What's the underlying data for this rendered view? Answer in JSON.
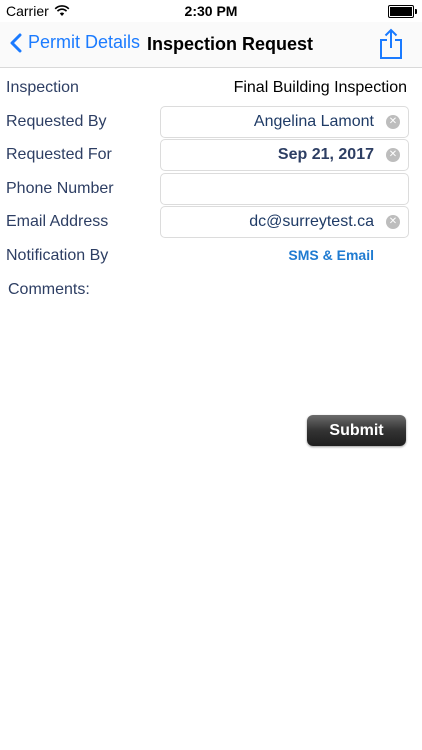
{
  "status_bar": {
    "carrier": "Carrier",
    "time": "2:30 PM"
  },
  "nav": {
    "back_label": "Permit Details",
    "title": "Inspection Request"
  },
  "form": {
    "inspection": {
      "label": "Inspection",
      "value": "Final Building Inspection"
    },
    "requested_by": {
      "label": "Requested By",
      "value": "Angelina Lamont"
    },
    "requested_for": {
      "label": "Requested For",
      "value": "Sep 21, 2017"
    },
    "phone": {
      "label": "Phone Number",
      "value": ""
    },
    "email": {
      "label": "Email Address",
      "value": "dc@surreytest.ca"
    },
    "notification": {
      "label": "Notification By",
      "value": "SMS & Email"
    },
    "comments": {
      "label": "Comments:"
    }
  },
  "actions": {
    "submit_label": "Submit"
  },
  "colors": {
    "accent": "#1b7bff",
    "label": "#2d3e63",
    "link": "#1f7bd1"
  }
}
